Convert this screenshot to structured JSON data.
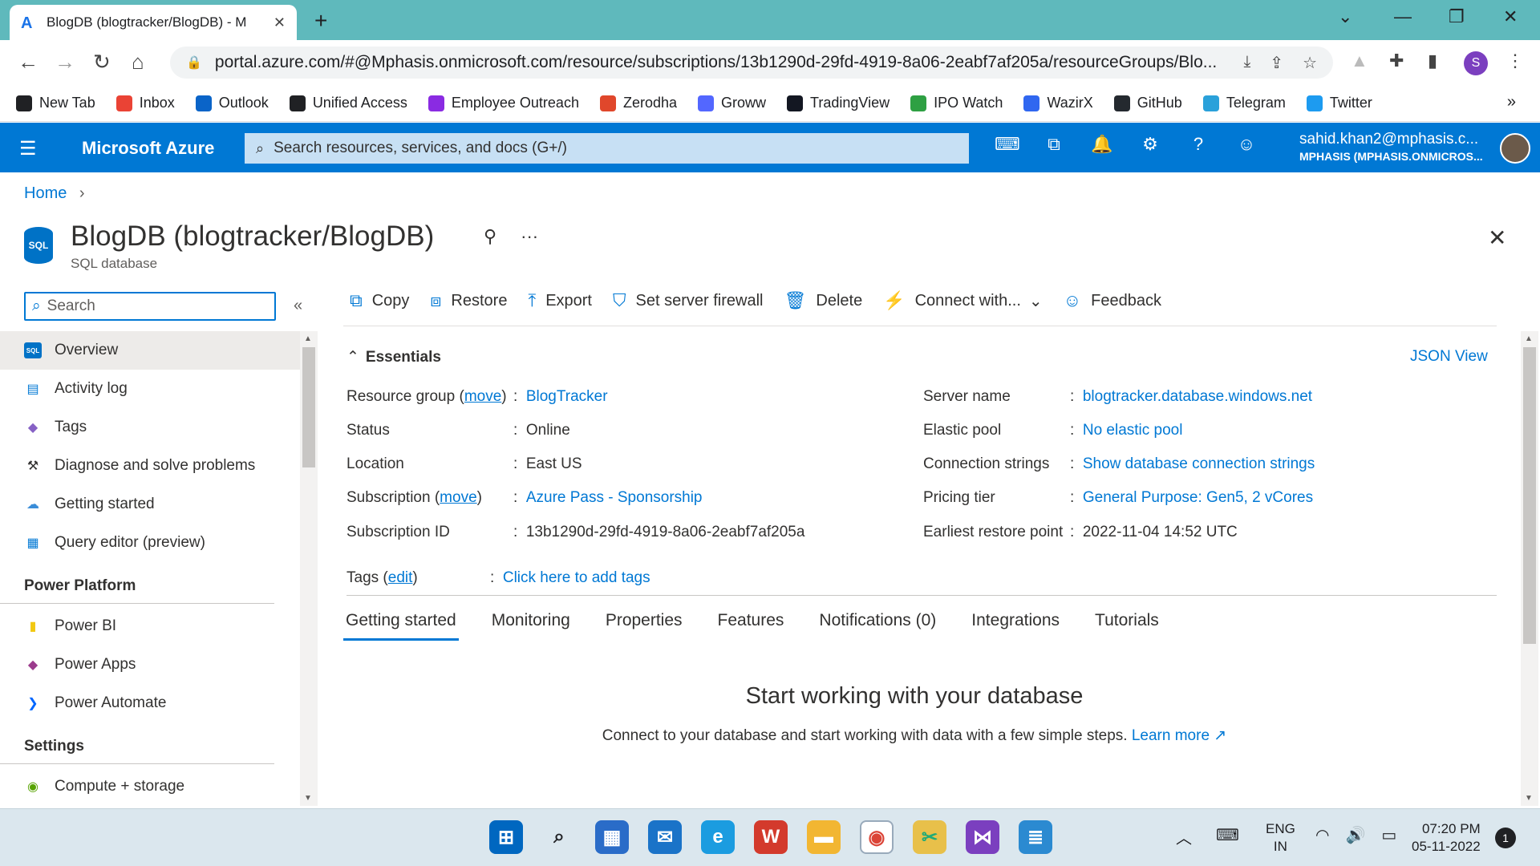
{
  "browser": {
    "tab_title": "BlogDB (blogtracker/BlogDB) - M",
    "url": "portal.azure.com/#@Mphasis.onmicrosoft.com/resource/subscriptions/13b1290d-29fd-4919-8a06-2eabf7af205a/resourceGroups/Blo...",
    "bookmarks": [
      {
        "label": "New Tab",
        "color": "#202124"
      },
      {
        "label": "Inbox",
        "color": "#ea4335"
      },
      {
        "label": "Outlook",
        "color": "#0a64c8"
      },
      {
        "label": "Unified Access",
        "color": "#202124"
      },
      {
        "label": "Employee Outreach",
        "color": "#8a2be2"
      },
      {
        "label": "Zerodha",
        "color": "#e0472b"
      },
      {
        "label": "Groww",
        "color": "#5367ff"
      },
      {
        "label": "TradingView",
        "color": "#131722"
      },
      {
        "label": "IPO Watch",
        "color": "#2ea043"
      },
      {
        "label": "WazirX",
        "color": "#3067f0"
      },
      {
        "label": "GitHub",
        "color": "#24292f"
      },
      {
        "label": "Telegram",
        "color": "#2aa1da"
      },
      {
        "label": "Twitter",
        "color": "#1d9bf0"
      }
    ],
    "profile_initial": "S"
  },
  "azure": {
    "brand": "Microsoft Azure",
    "search_placeholder": "Search resources, services, and docs (G+/)",
    "user_email": "sahid.khan2@mphasis.c...",
    "user_tenant": "MPHASIS (MPHASIS.ONMICROS..."
  },
  "breadcrumb": {
    "home": "Home"
  },
  "resource": {
    "title": "BlogDB (blogtracker/BlogDB)",
    "subtitle": "SQL database",
    "icon_label": "SQL"
  },
  "left_nav": {
    "search_placeholder": "Search",
    "items": [
      {
        "label": "Overview",
        "icon": "sql-icon",
        "active": true
      },
      {
        "label": "Activity log",
        "icon": "activity-log-icon"
      },
      {
        "label": "Tags",
        "icon": "tag-icon"
      },
      {
        "label": "Diagnose and solve problems",
        "icon": "wrench-icon"
      },
      {
        "label": "Getting started",
        "icon": "cloud-icon"
      },
      {
        "label": "Query editor (preview)",
        "icon": "grid-icon"
      }
    ],
    "section_power": "Power Platform",
    "power_items": [
      {
        "label": "Power BI",
        "icon": "power-bi-icon"
      },
      {
        "label": "Power Apps",
        "icon": "power-apps-icon"
      },
      {
        "label": "Power Automate",
        "icon": "power-automate-icon"
      }
    ],
    "section_settings": "Settings",
    "settings_items": [
      {
        "label": "Compute + storage",
        "icon": "compute-icon"
      }
    ]
  },
  "commands": {
    "copy": "Copy",
    "restore": "Restore",
    "export": "Export",
    "firewall": "Set server firewall",
    "delete": "Delete",
    "connect": "Connect with...",
    "feedback": "Feedback"
  },
  "essentials": {
    "heading": "Essentials",
    "json_view": "JSON View",
    "resource_group_label": "Resource group",
    "move": "move",
    "resource_group": "BlogTracker",
    "status_label": "Status",
    "status": "Online",
    "location_label": "Location",
    "location": "East US",
    "subscription_label": "Subscription",
    "subscription": "Azure Pass - Sponsorship",
    "subscription_id_label": "Subscription ID",
    "subscription_id": "13b1290d-29fd-4919-8a06-2eabf7af205a",
    "server_name_label": "Server name",
    "server_name": "blogtracker.database.windows.net",
    "elastic_pool_label": "Elastic pool",
    "elastic_pool": "No elastic pool",
    "conn_strings_label": "Connection strings",
    "conn_strings": "Show database connection strings",
    "pricing_label": "Pricing tier",
    "pricing": "General Purpose: Gen5, 2 vCores",
    "restore_label": "Earliest restore point",
    "restore_point": "2022-11-04 14:52 UTC",
    "tags_label": "Tags",
    "edit": "edit",
    "tags_link": "Click here to add tags"
  },
  "tabs": [
    "Getting started",
    "Monitoring",
    "Properties",
    "Features",
    "Notifications (0)",
    "Integrations",
    "Tutorials"
  ],
  "getting_started": {
    "title": "Start working with your database",
    "subtitle": "Connect to your database and start working with data with a few simple steps.",
    "learn_more": "Learn more"
  },
  "taskbar": {
    "lang1": "ENG",
    "lang2": "IN",
    "time": "07:20 PM",
    "date": "05-11-2022",
    "notifications": "1"
  }
}
